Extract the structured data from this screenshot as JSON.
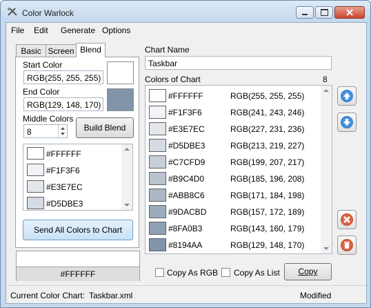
{
  "window": {
    "title": "Color Warlock"
  },
  "menu": [
    "File",
    "Edit",
    "Generate",
    "Options"
  ],
  "tabs": [
    {
      "label": "Basic",
      "active": false
    },
    {
      "label": "Screen",
      "active": false
    },
    {
      "label": "Blend",
      "active": true
    }
  ],
  "blend": {
    "start_label": "Start Color",
    "start_value": "RGB(255, 255, 255)",
    "start_color": "#FFFFFF",
    "end_label": "End Color",
    "end_value": "RGB(129, 148, 170)",
    "end_color": "#8194AA",
    "middle_label": "Middle Colors",
    "middle_value": "8",
    "build_button": "Build Blend",
    "preview_list": [
      {
        "hex": "#FFFFFF",
        "color": "#FFFFFF"
      },
      {
        "hex": "#F1F3F6",
        "color": "#F1F3F6"
      },
      {
        "hex": "#E3E7EC",
        "color": "#E3E7EC"
      },
      {
        "hex": "#D5DBE3",
        "color": "#D5DBE3"
      }
    ],
    "send_button": "Send All Colors to Chart"
  },
  "selected": {
    "hex": "#FFFFFF",
    "color": "#FFFFFF"
  },
  "chart": {
    "name_label": "Chart Name",
    "name_value": "Taskbar",
    "colors_label": "Colors of Chart",
    "count": "8",
    "colors": [
      {
        "hex": "#FFFFFF",
        "rgb": "RGB(255, 255, 255)",
        "color": "#FFFFFF"
      },
      {
        "hex": "#F1F3F6",
        "rgb": "RGB(241, 243, 246)",
        "color": "#F1F3F6"
      },
      {
        "hex": "#E3E7EC",
        "rgb": "RGB(227, 231, 236)",
        "color": "#E3E7EC"
      },
      {
        "hex": "#D5DBE3",
        "rgb": "RGB(213, 219, 227)",
        "color": "#D5DBE3"
      },
      {
        "hex": "#C7CFD9",
        "rgb": "RGB(199, 207, 217)",
        "color": "#C7CFD9"
      },
      {
        "hex": "#B9C4D0",
        "rgb": "RGB(185, 196, 208)",
        "color": "#B9C4D0"
      },
      {
        "hex": "#ABB8C6",
        "rgb": "RGB(171, 184, 198)",
        "color": "#ABB8C6"
      },
      {
        "hex": "#9DACBD",
        "rgb": "RGB(157, 172, 189)",
        "color": "#9DACBD"
      },
      {
        "hex": "#8FA0B3",
        "rgb": "RGB(143, 160, 179)",
        "color": "#8FA0B3"
      },
      {
        "hex": "#8194AA",
        "rgb": "RGB(129, 148, 170)",
        "color": "#8194AA"
      }
    ],
    "copy_as_rgb": "Copy As RGB",
    "copy_as_list": "Copy As List",
    "copy_button": "Copy"
  },
  "status": {
    "label": "Current Color Chart:",
    "file": "Taskbar.xml",
    "state": "Modified"
  },
  "icons": {
    "move_up": "arrow-up-icon",
    "move_down": "arrow-down-icon",
    "remove": "x-icon",
    "delete": "trash-icon"
  }
}
